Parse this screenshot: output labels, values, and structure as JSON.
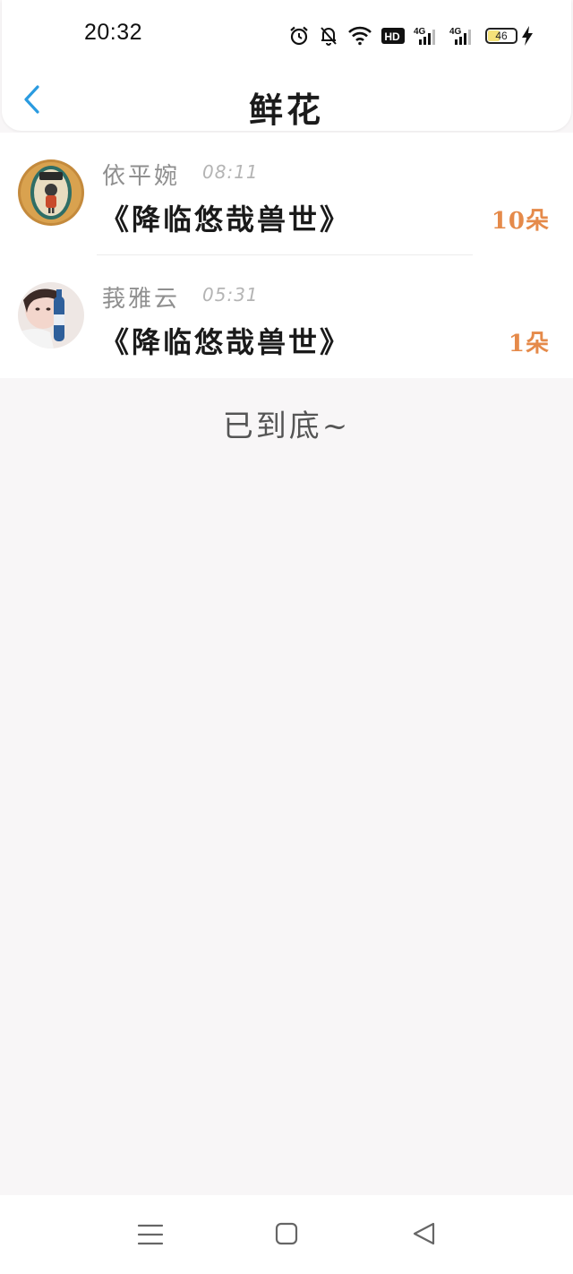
{
  "status_bar": {
    "time": "20:32",
    "battery_level": "46",
    "battery_fraction": 0.46,
    "icons": [
      "alarm-icon",
      "bell-off-icon",
      "wifi-icon",
      "hd-icon",
      "signal-4g-icon",
      "signal-4g-icon",
      "battery-icon",
      "charging-icon"
    ],
    "hd_label": "HD",
    "network_label": "4G"
  },
  "header": {
    "title": "鲜花",
    "back_icon": "chevron-left-icon",
    "accent_color": "#2a9be0"
  },
  "list": {
    "items": [
      {
        "user": "依平婉",
        "time": "08:11",
        "book": "《降临悠哉兽世》",
        "count": "10朵"
      },
      {
        "user": "莪雅云",
        "time": "05:31",
        "book": "《降临悠哉兽世》",
        "count": "1朵"
      }
    ],
    "count_color": "#e58a4a"
  },
  "end_hint": "已到底~",
  "nav_bar": {
    "icons": [
      "menu-icon",
      "home-square-icon",
      "back-triangle-icon"
    ]
  }
}
